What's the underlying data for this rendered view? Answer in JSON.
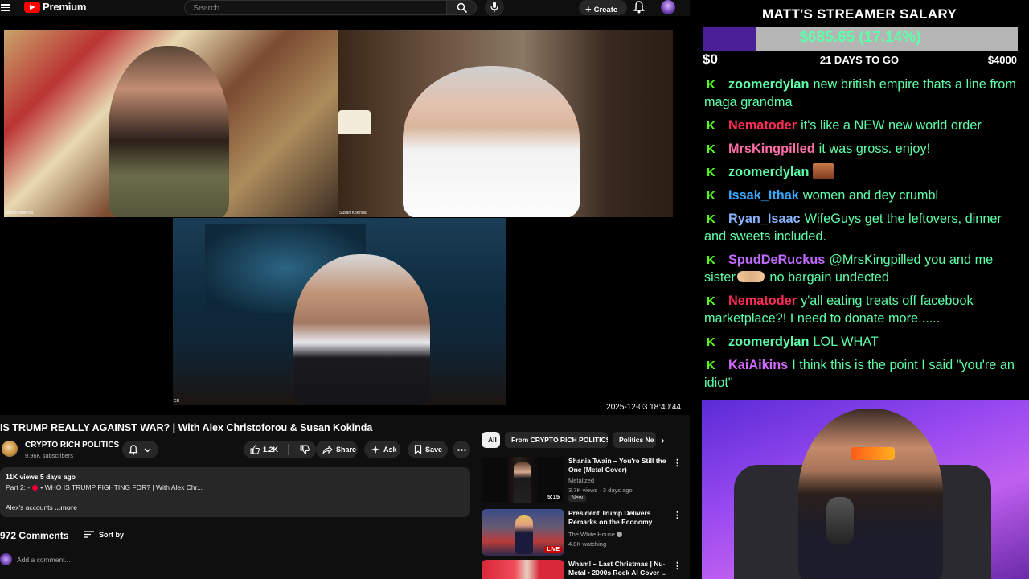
{
  "youtube": {
    "brand": "Premium",
    "search_placeholder": "Search",
    "create_label": "Create",
    "overlay_timestamp": "2025-12-03 18:40:44",
    "participants": [
      "alexchristoforou",
      "Susan Kokinda",
      "CR"
    ],
    "video": {
      "title": "IS TRUMP REALLY AGAINST WAR? | With Alex Christoforou & Susan Kokinda",
      "channel": "CRYPTO RICH POLITICS",
      "subscribers": "9.96K subscribers",
      "likes": "1.2K",
      "share_label": "Share",
      "ask_label": "Ask",
      "save_label": "Save"
    },
    "description": {
      "views_line": "11K views  5 days ago",
      "part_prefix": "Part 2: -",
      "part_text": "• WHO IS TRUMP FIGHTING FOR? | With Alex Chr...",
      "accounts_text": "Alex's accounts ",
      "more_label": "...more"
    },
    "comments": {
      "count": "972 Comments",
      "sort_label": "Sort by",
      "add_placeholder": "Add a comment..."
    },
    "chips": [
      "All",
      "From CRYPTO RICH POLITICS",
      "Politics Ne"
    ],
    "recommendations": [
      {
        "title": "Shania Twain – You're Still the One (Metal Cover)",
        "channel": "Metalized",
        "meta": "3.7K views · 3 days ago",
        "badge": "New",
        "duration": "5:15"
      },
      {
        "title": "President Trump Delivers Remarks on the Economy",
        "channel": "The White House",
        "meta": "4.8K watching",
        "live": "LIVE"
      },
      {
        "title": "Wham! – Last Christmas | Nu-Metal • 2000s Rock AI Cover ..."
      }
    ]
  },
  "stream": {
    "goal_title": "MATT'S STREAMER SALARY",
    "goal_amount": "$685.65 (17.14%)",
    "goal_fraction": 0.1714,
    "goal_min": "$0",
    "goal_days": "21 DAYS TO GO",
    "goal_max": "$4000",
    "chat": [
      {
        "user": "zoomerdylan",
        "color": "#5effa8",
        "text": "new british empire thats a line from maga grandma"
      },
      {
        "user": "Nematoder",
        "color": "#ff2d55",
        "text": "it's like a NEW new world order"
      },
      {
        "user": "MrsKingpilled",
        "color": "#ff6fa8",
        "text": "it was gross. enjoy!"
      },
      {
        "user": "zoomerdylan",
        "color": "#5effa8",
        "text": "",
        "emote": true
      },
      {
        "user": "Issak_Ithak",
        "color": "#3aa9ff",
        "text": "women and dey crumbl"
      },
      {
        "user": "Ryan_Isaac",
        "color": "#8ab4ff",
        "text": "WifeGuys get the leftovers, dinner and sweets included."
      },
      {
        "user": "SpudDeRuckus",
        "color": "#c06bff",
        "text": "@MrsKingpilled you and me sister",
        "text2": " no bargain undected",
        "fist": true
      },
      {
        "user": "Nematoder",
        "color": "#ff2d55",
        "text": "y'all eating treats off facebook marketplace?! I need to donate more......"
      },
      {
        "user": "zoomerdylan",
        "color": "#5effa8",
        "text": "LOL WHAT"
      },
      {
        "user": "KaiAikins",
        "color": "#d46bff",
        "text": "I think this is the point I said \"you're an idiot\""
      }
    ]
  }
}
